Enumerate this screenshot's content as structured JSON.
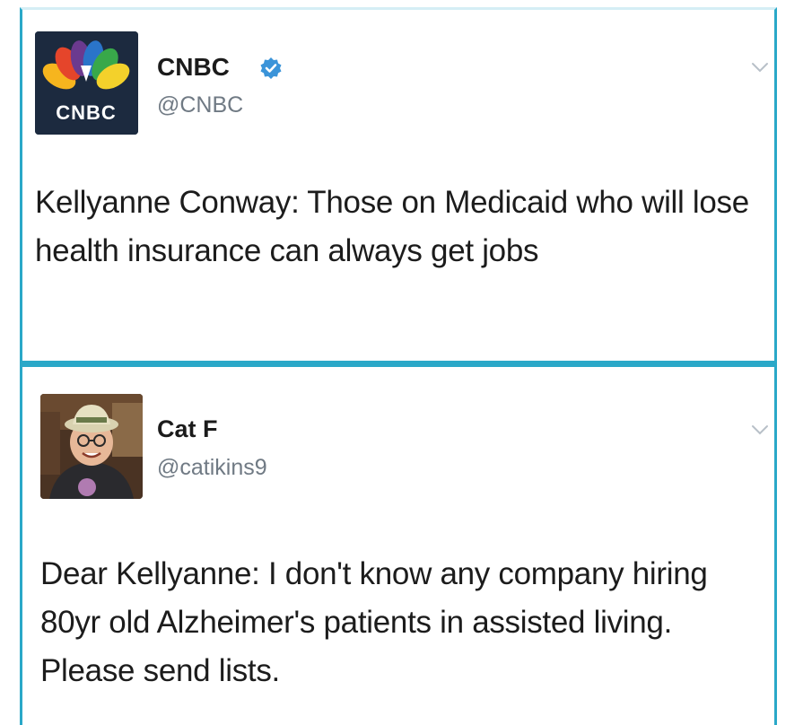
{
  "tweets": [
    {
      "avatar_icon": "cnbc-peacock-logo",
      "avatar_text": "CNBC",
      "name": "CNBC",
      "verified": true,
      "handle": "@CNBC",
      "text": "Kellyanne Conway: Those on Medicaid who will lose health insurance can always get jobs"
    },
    {
      "avatar_icon": "profile-photo",
      "name": "Cat F",
      "verified": false,
      "handle": "@catikins9",
      "text": "Dear Kellyanne: I don't know any company hiring 80yr old Alzheimer's patients in assisted living. Please send lists."
    }
  ],
  "colors": {
    "border": "#2aa8c8",
    "verified": "#3b94d9",
    "handle": "#707a84",
    "text": "#1c1c1c"
  }
}
